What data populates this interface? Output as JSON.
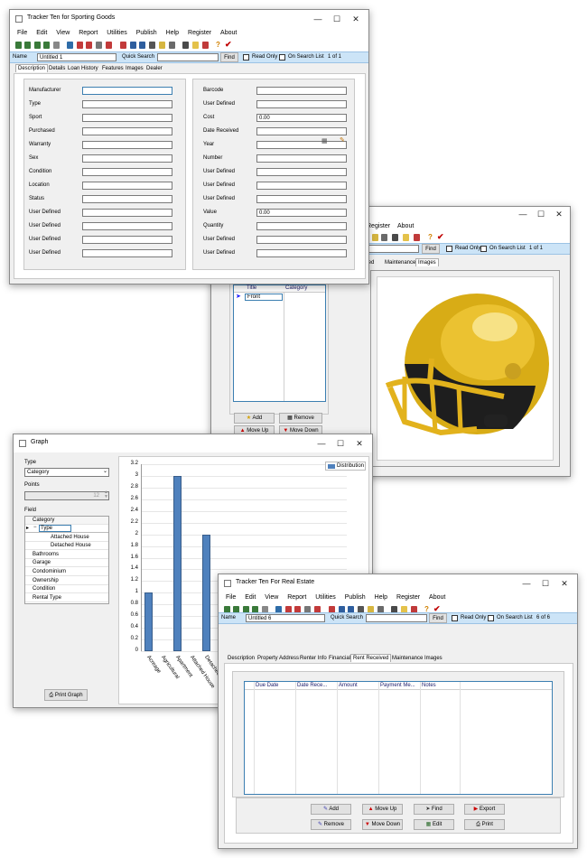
{
  "w1": {
    "title": "Tracker Ten for Sporting Goods",
    "menu": [
      "File",
      "Edit",
      "View",
      "Report",
      "Utilities",
      "Publish",
      "Help",
      "Register",
      "About"
    ],
    "name_label": "Name",
    "name_value": "Untitled 1",
    "quick_search_label": "Quick Search",
    "find_label": "Find",
    "read_only_label": "Read Only",
    "on_search_list_label": "On Search List",
    "record_count": "1 of 1",
    "tabs": [
      "Description",
      "Details",
      "Loan History",
      "Features",
      "Images",
      "Dealer"
    ],
    "left_fields": [
      {
        "label": "Manufacturer",
        "value": ""
      },
      {
        "label": "Type",
        "value": ""
      },
      {
        "label": "Sport",
        "value": ""
      },
      {
        "label": "Purchased",
        "value": ""
      },
      {
        "label": "Warranty",
        "value": ""
      },
      {
        "label": "Sex",
        "value": ""
      },
      {
        "label": "Condition",
        "value": ""
      },
      {
        "label": "Location",
        "value": ""
      },
      {
        "label": "Status",
        "value": ""
      },
      {
        "label": "User Defined",
        "value": ""
      },
      {
        "label": "User Defined",
        "value": ""
      },
      {
        "label": "User Defined",
        "value": ""
      },
      {
        "label": "User Defined",
        "value": ""
      }
    ],
    "right_fields": [
      {
        "label": "Barcode",
        "value": ""
      },
      {
        "label": "User Defined",
        "value": ""
      },
      {
        "label": "Cost",
        "value": "0.00"
      },
      {
        "label": "Date Received",
        "value": ""
      },
      {
        "label": "Year",
        "value": ""
      },
      {
        "label": "Number",
        "value": ""
      },
      {
        "label": "User Defined",
        "value": ""
      },
      {
        "label": "User Defined",
        "value": ""
      },
      {
        "label": "User Defined",
        "value": ""
      },
      {
        "label": "Value",
        "value": "0.00"
      },
      {
        "label": "Quantity",
        "value": ""
      },
      {
        "label": "User Defined",
        "value": ""
      },
      {
        "label": "User Defined",
        "value": ""
      }
    ]
  },
  "w2": {
    "menu": [
      "Register",
      "About"
    ],
    "find_label": "Find",
    "read_only_label": "Read Only",
    "on_search_list_label": "On Search List",
    "record_count": "1 of 1",
    "tabs": [
      "eived",
      "Maintenance",
      "Images"
    ],
    "list_headers": [
      "Title",
      "Category"
    ],
    "list_row": "Front",
    "add_label": "Add",
    "remove_label": "Remove",
    "move_up_label": "Move Up",
    "move_down_label": "Move Down"
  },
  "w3": {
    "title": "Graph",
    "type_label": "Type",
    "type_value": "Category",
    "points_label": "Points",
    "points_value": "12",
    "field_label": "Field",
    "field_header": "Category",
    "field_rows": [
      {
        "text": "Type",
        "indent": 1,
        "expand": "−"
      },
      {
        "text": "Attached House",
        "indent": 2,
        "expand": ""
      },
      {
        "text": "Detached House",
        "indent": 2,
        "expand": ""
      },
      {
        "text": "Bathrooms",
        "indent": 0,
        "expand": ""
      },
      {
        "text": "Garage",
        "indent": 0,
        "expand": ""
      },
      {
        "text": "Condominium",
        "indent": 0,
        "expand": ""
      },
      {
        "text": "Ownership",
        "indent": 0,
        "expand": ""
      },
      {
        "text": "Condition",
        "indent": 0,
        "expand": ""
      },
      {
        "text": "Rental Type",
        "indent": 0,
        "expand": ""
      }
    ],
    "print_label": "Print Graph",
    "legend_label": "Distribution"
  },
  "w4": {
    "title": "Tracker Ten For Real Estate",
    "menu": [
      "File",
      "Edit",
      "View",
      "Report",
      "Utilities",
      "Publish",
      "Help",
      "Register",
      "About"
    ],
    "name_label": "Name",
    "name_value": "Untitled 6",
    "quick_search_label": "Quick Search",
    "find_label": "Find",
    "read_only_label": "Read Only",
    "on_search_list_label": "On Search List",
    "record_count": "6 of 6",
    "tabs": [
      "Description",
      "Property Address",
      "Renter Info",
      "Financial",
      "Rent Received",
      "Maintenance",
      "Images"
    ],
    "columns": [
      "Due Date",
      "Date Rece...",
      "Amount",
      "Payment Me...",
      "Notes"
    ],
    "buttons": [
      {
        "label": "Add",
        "icon": "add-icon"
      },
      {
        "label": "Move Up",
        "icon": "arrow-up-icon"
      },
      {
        "label": "Find",
        "icon": "find-icon"
      },
      {
        "label": "Export",
        "icon": "export-icon"
      },
      {
        "label": "Remove",
        "icon": "remove-icon"
      },
      {
        "label": "Move Down",
        "icon": "arrow-down-icon"
      },
      {
        "label": "Edit",
        "icon": "edit-icon"
      },
      {
        "label": "Print",
        "icon": "printer-icon"
      }
    ]
  },
  "chart_data": {
    "type": "bar",
    "categories": [
      "Acreage",
      "Agricultural",
      "Apartment",
      "Attached House",
      "Detached House",
      "Mobile"
    ],
    "series": [
      {
        "name": "Distribution",
        "values": [
          1,
          0,
          3,
          0,
          2,
          0
        ]
      }
    ],
    "ylim": [
      0,
      3.2
    ],
    "yticks": [
      "0",
      "0.2",
      "0.4",
      "0.6",
      "0.8",
      "1",
      "1.2",
      "1.4",
      "1.6",
      "1.8",
      "2",
      "2.2",
      "2.4",
      "2.6",
      "2.8",
      "3",
      "3.2"
    ],
    "grid": true,
    "legend": "top-right",
    "colors": {
      "bar": "#4f81bd"
    }
  }
}
